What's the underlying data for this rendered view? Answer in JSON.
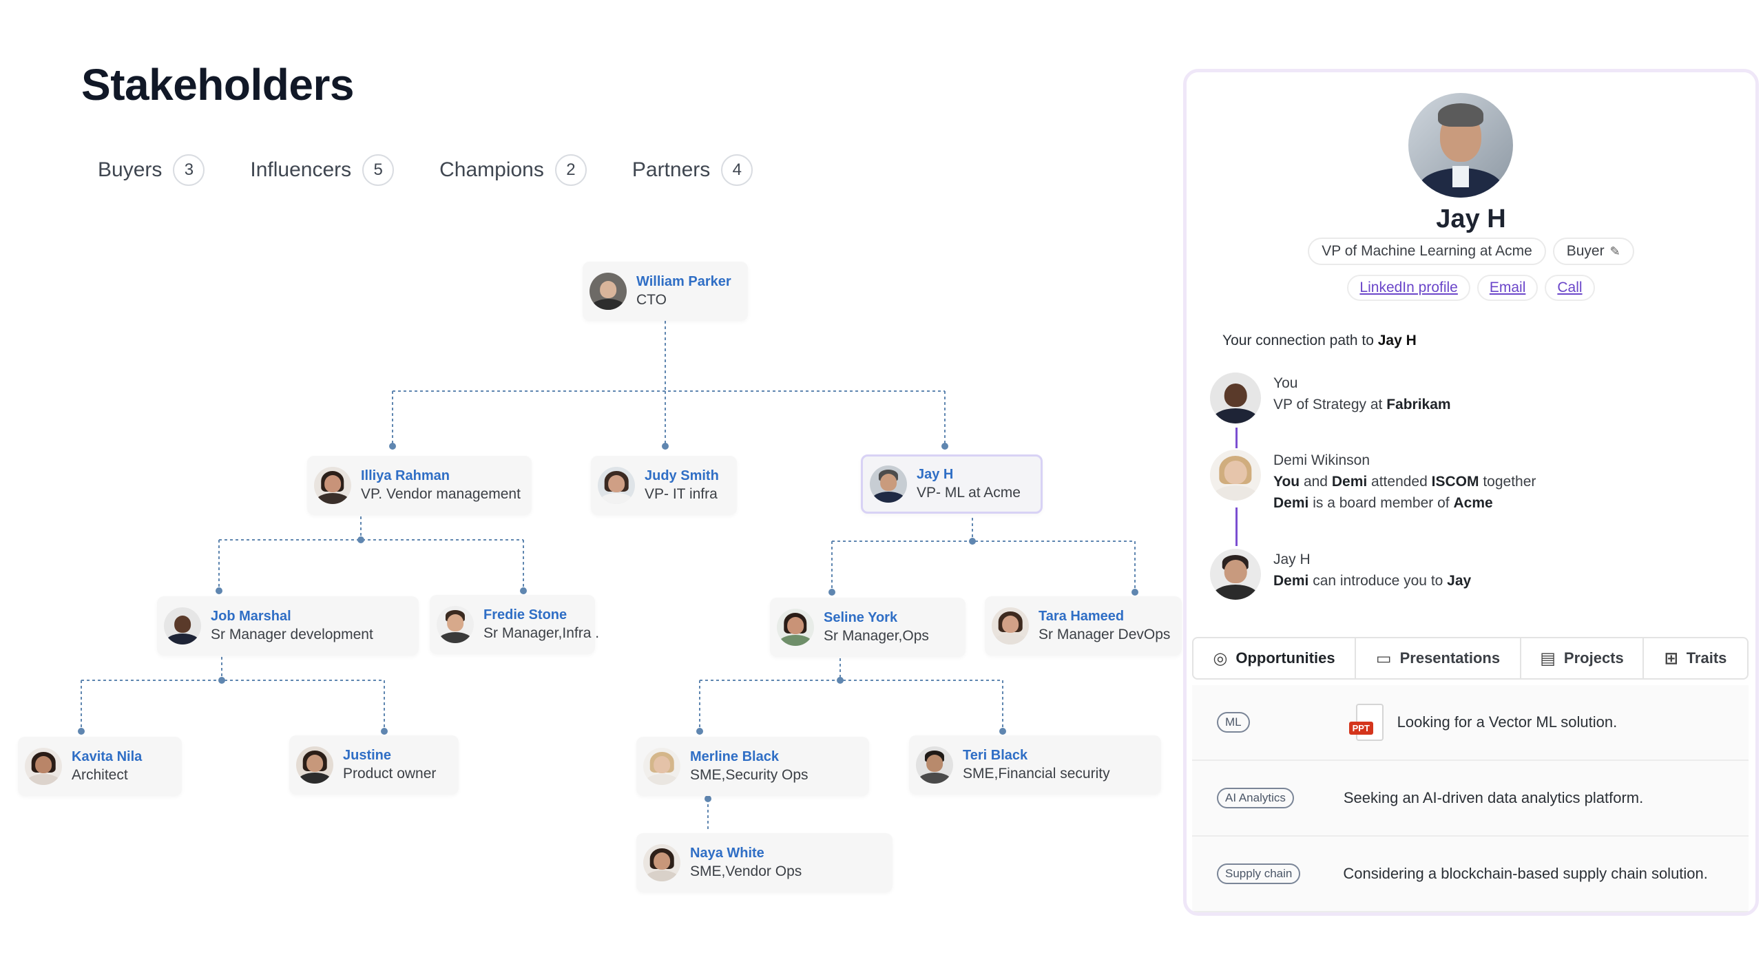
{
  "page": {
    "title": "Stakeholders"
  },
  "filters": [
    {
      "label": "Buyers",
      "count": "3"
    },
    {
      "label": "Influencers",
      "count": "5"
    },
    {
      "label": "Champions",
      "count": "2"
    },
    {
      "label": "Partners",
      "count": "4"
    }
  ],
  "org": {
    "william": {
      "name": "William Parker",
      "role": "CTO"
    },
    "illiya": {
      "name": "Illiya Rahman",
      "role": "VP. Vendor management"
    },
    "judy": {
      "name": "Judy Smith",
      "role": "VP- IT infra"
    },
    "jay": {
      "name": "Jay H",
      "role": "VP- ML at Acme"
    },
    "job": {
      "name": "Job Marshal",
      "role": "Sr Manager development"
    },
    "fredie": {
      "name": "Fredie Stone",
      "role": "Sr Manager,Infra ."
    },
    "seline": {
      "name": "Seline York",
      "role": "Sr Manager,Ops"
    },
    "tara": {
      "name": "Tara Hameed",
      "role": "Sr Manager DevOps"
    },
    "kavita": {
      "name": "Kavita Nila",
      "role": "Architect"
    },
    "justine": {
      "name": "Justine",
      "role": "Product owner"
    },
    "merline": {
      "name": "Merline Black",
      "role": "SME,Security Ops"
    },
    "teri": {
      "name": "Teri Black",
      "role": "SME,Financial security"
    },
    "naya": {
      "name": "Naya White",
      "role": "SME,Vendor Ops"
    }
  },
  "profile": {
    "name": "Jay H",
    "title_chip": "VP of Machine Learning at Acme",
    "role_chip": "Buyer",
    "links": {
      "linkedin": "LinkedIn profile",
      "email": "Email",
      "call": "Call"
    },
    "connection": {
      "title_prefix": "Your connection path to",
      "title_name": "Jay H",
      "you": {
        "name": "You",
        "line_prefix": "VP of Strategy at",
        "company": "Fabrikam"
      },
      "demi": {
        "name": "Demi Wikinson",
        "line1_a": "You",
        "line1_b": "and",
        "line1_c": "Demi",
        "line1_d": "attended",
        "line1_e": "ISCOM",
        "line1_f": "together",
        "line2_a": "Demi",
        "line2_b": "is a board member of",
        "line2_c": "Acme"
      },
      "jay": {
        "name": "Jay H",
        "line_a": "Demi",
        "line_b": "can introduce you to",
        "line_c": "Jay"
      }
    }
  },
  "tabs": [
    {
      "label": "Opportunities",
      "icon": "target-icon"
    },
    {
      "label": "Presentations",
      "icon": "calendar-icon"
    },
    {
      "label": "Projects",
      "icon": "card-icon"
    },
    {
      "label": "Traits",
      "icon": "grid-icon"
    }
  ],
  "opportunities": [
    {
      "tag": "ML",
      "doc_badge": "PPT",
      "text": "Looking for a Vector ML solution."
    },
    {
      "tag": "AI Analytics",
      "text": "Seeking an AI-driven data analytics platform."
    },
    {
      "tag": "Supply chain",
      "text": "Considering a blockchain-based supply chain solution."
    }
  ]
}
